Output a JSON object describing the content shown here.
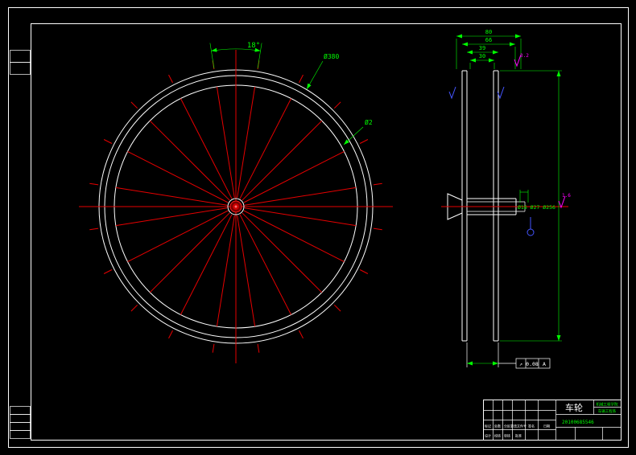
{
  "colors": {
    "background": "#000000",
    "geometry": "#ffffff",
    "centerline": "#e60000",
    "dimension": "#00ff00",
    "roughness": "#ff00ff",
    "datum": "#4455ff"
  },
  "drawing": {
    "front_view": {
      "angle_dim": "18°",
      "diameter_dim": "Ø380",
      "spoke_dim": "Ø2"
    },
    "side_view": {
      "width_dims": [
        "80",
        "66",
        "39",
        "30"
      ],
      "hub_dims": "Ø16 Ø27 Ø256",
      "roughness_top": "3.2",
      "roughness_right": "1.6",
      "tolerance": {
        "symbol": "↗",
        "value": "0.08",
        "datum": "A"
      }
    }
  },
  "title_block": {
    "part_name": "车轮",
    "org_line1": "机械工程学院",
    "org_line2": "车辆工程系",
    "drawing_no": "20100685546",
    "row3": [
      "标记",
      "处数",
      "分区",
      "更改文件号",
      "签名",
      "日期"
    ],
    "row4": [
      "设计",
      "校核",
      "审核",
      "批准"
    ]
  }
}
